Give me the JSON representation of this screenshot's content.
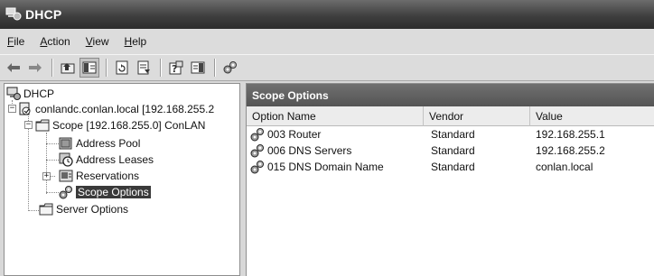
{
  "window": {
    "title": "DHCP"
  },
  "menu": [
    {
      "label": "File",
      "mnemonic": "F",
      "rest": "ile"
    },
    {
      "label": "Action",
      "mnemonic": "A",
      "rest": "ction"
    },
    {
      "label": "View",
      "mnemonic": "V",
      "rest": "iew"
    },
    {
      "label": "Help",
      "mnemonic": "H",
      "rest": "elp"
    }
  ],
  "toolbar": {
    "buttons": [
      "back-arrow-icon",
      "forward-arrow-icon",
      "up-folder-icon",
      "show-hide-tree-icon",
      "refresh-icon",
      "export-list-icon",
      "help-icon",
      "console-tree-icon",
      "scope-options-icon"
    ]
  },
  "tree": {
    "root": "DHCP",
    "server": "conlandc.conlan.local [192.168.255.2",
    "scope": "Scope [192.168.255.0] ConLAN",
    "address_pool": "Address Pool",
    "address_leases": "Address Leases",
    "reservations": "Reservations",
    "scope_options": "Scope Options",
    "server_options": "Server Options",
    "selected": "Scope Options"
  },
  "result_pane": {
    "title": "Scope Options",
    "columns": [
      "Option Name",
      "Vendor",
      "Value"
    ],
    "rows": [
      {
        "name": "003 Router",
        "vendor": "Standard",
        "value": "192.168.255.1"
      },
      {
        "name": "006 DNS Servers",
        "vendor": "Standard",
        "value": "192.168.255.2"
      },
      {
        "name": "015 DNS Domain Name",
        "vendor": "Standard",
        "value": "conlan.local"
      }
    ]
  },
  "colors": {
    "title_bar": "#3f3f3f",
    "pane_header": "#5a5a5a",
    "selection": "#3a3a3a"
  }
}
